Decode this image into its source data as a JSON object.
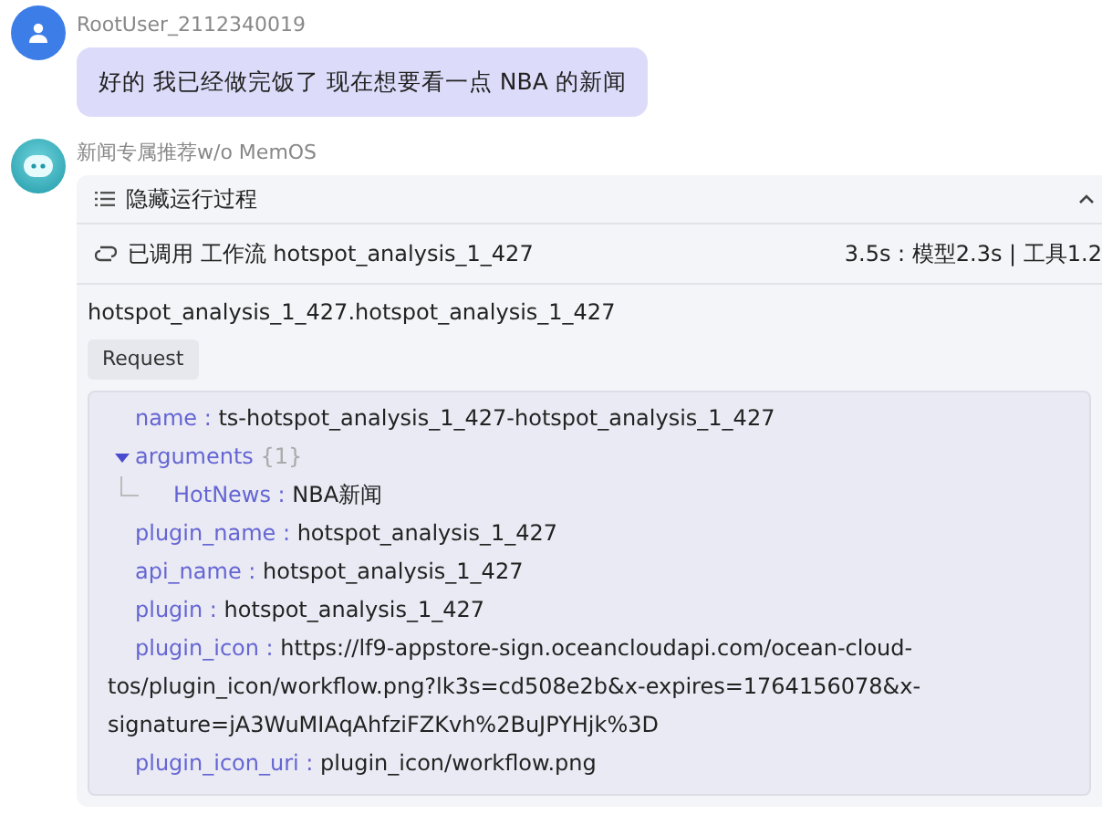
{
  "user_message": {
    "author": "RootUser_2112340019",
    "text": "好的 我已经做完饭了 现在想要看一点 NBA 的新闻"
  },
  "bot_message": {
    "author": "新闻专属推荐w/o MemOS",
    "process_toggle": {
      "label": "隐藏运行过程",
      "expanded": true
    },
    "call": {
      "status": "已调用",
      "type": "工作流",
      "name": "hotspot_analysis_1_427",
      "timing": "3.5s : 模型2.3s | 工具1.2"
    },
    "tool_title": "hotspot_analysis_1_427.hotspot_analysis_1_427",
    "request_tab": "Request",
    "fields": [
      {
        "key": "name :",
        "value": "ts-hotspot_analysis_1_427-hotspot_analysis_1_427"
      },
      {
        "key": "arguments",
        "count": "{1}",
        "expanded": true,
        "children": [
          {
            "key": "HotNews :",
            "value": "NBA新闻"
          }
        ]
      },
      {
        "key": "plugin_name :",
        "value": "hotspot_analysis_1_427"
      },
      {
        "key": "api_name :",
        "value": "hotspot_analysis_1_427"
      },
      {
        "key": "plugin :",
        "value": "hotspot_analysis_1_427"
      },
      {
        "key": "plugin_icon :",
        "value": "https://lf9-appstore-sign.oceancloudapi.com/ocean-cloud-tos/plugin_icon/workflow.png?lk3s=cd508e2b&x-expires=1764156078&x-signature=jA3WuMIAqAhfziFZKvh%2BuJPYHjk%3D"
      },
      {
        "key": "plugin_icon_uri :",
        "value": "plugin_icon/workflow.png"
      }
    ]
  }
}
